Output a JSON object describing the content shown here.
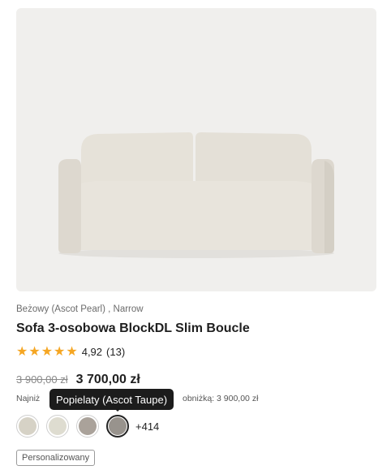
{
  "product": {
    "variant": "Beżowy (Ascot Pearl) , Narrow",
    "title": "Sofa 3-osobowa BlockDL Slim Boucle",
    "rating": {
      "stars": 5,
      "value": "4,92",
      "count": "(13)"
    },
    "old_price": "3 900,00 zł",
    "price": "3 700,00 zł",
    "lowest_price_prefix": "Najniż",
    "lowest_price_suffix": "obniżką: 3 900,00 zł",
    "tooltip": "Popielaty (Ascot Taupe)",
    "swatches": [
      {
        "name": "swatch-beige",
        "color": "#d6d2c6",
        "selected": false
      },
      {
        "name": "swatch-light-beige",
        "color": "#dedcd0",
        "selected": false
      },
      {
        "name": "swatch-taupe",
        "color": "#aaa29a",
        "selected": false
      },
      {
        "name": "swatch-grey",
        "color": "#98938d",
        "selected": true
      }
    ],
    "more_colors": "+414",
    "badge": "Personalizowany"
  },
  "colors": {
    "star": "#f5a623",
    "image_bg": "#f0efed",
    "sofa": "#e3dfd6"
  }
}
